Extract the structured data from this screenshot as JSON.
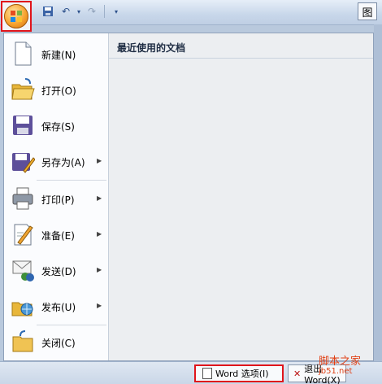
{
  "qat": {
    "save_icon": "save-icon",
    "undo_icon": "undo-icon",
    "redo_icon": "redo-icon",
    "customize_icon": "customize-qat-icon",
    "right_partial_label": "图"
  },
  "menu": {
    "items": [
      {
        "label": "新建(N)",
        "icon": "new-document-icon",
        "has_submenu": false
      },
      {
        "label": "打开(O)",
        "icon": "open-folder-icon",
        "has_submenu": false
      },
      {
        "label": "保存(S)",
        "icon": "save-disk-icon",
        "has_submenu": false
      },
      {
        "label": "另存为(A)",
        "icon": "save-as-icon",
        "has_submenu": true
      },
      {
        "label": "打印(P)",
        "icon": "printer-icon",
        "has_submenu": true
      },
      {
        "label": "准备(E)",
        "icon": "prepare-icon",
        "has_submenu": true
      },
      {
        "label": "发送(D)",
        "icon": "send-icon",
        "has_submenu": true
      },
      {
        "label": "发布(U)",
        "icon": "publish-icon",
        "has_submenu": true
      },
      {
        "label": "关闭(C)",
        "icon": "close-folder-icon",
        "has_submenu": false
      }
    ],
    "recent_title": "最近使用的文档"
  },
  "bottom": {
    "word_options_label": "Word 选项(I)",
    "exit_label": "退出 Word(X)"
  },
  "watermark": {
    "line1": "脚本之家",
    "line2": "jb51.net"
  },
  "colors": {
    "highlight_border": "#e0141b",
    "menu_bg": "#ffffff",
    "recent_bg": "#eceef1"
  }
}
